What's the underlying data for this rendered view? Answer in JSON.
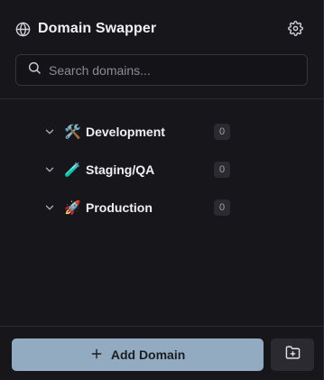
{
  "header": {
    "title": "Domain Swapper",
    "globe_icon": "globe-icon",
    "settings_icon": "gear-icon"
  },
  "search": {
    "placeholder": "Search domains...",
    "value": ""
  },
  "groups": [
    {
      "emoji": "🛠️",
      "label": "Development",
      "count": "0"
    },
    {
      "emoji": "🧪",
      "label": "Staging/QA",
      "count": "0"
    },
    {
      "emoji": "🚀",
      "label": "Production",
      "count": "0"
    }
  ],
  "footer": {
    "add_label": "Add Domain",
    "add_icon": "plus-icon",
    "folder_icon": "folder-plus-icon"
  },
  "colors": {
    "background": "#17171b",
    "accent_button": "#93abc1",
    "badge_bg": "#2a2a30"
  }
}
